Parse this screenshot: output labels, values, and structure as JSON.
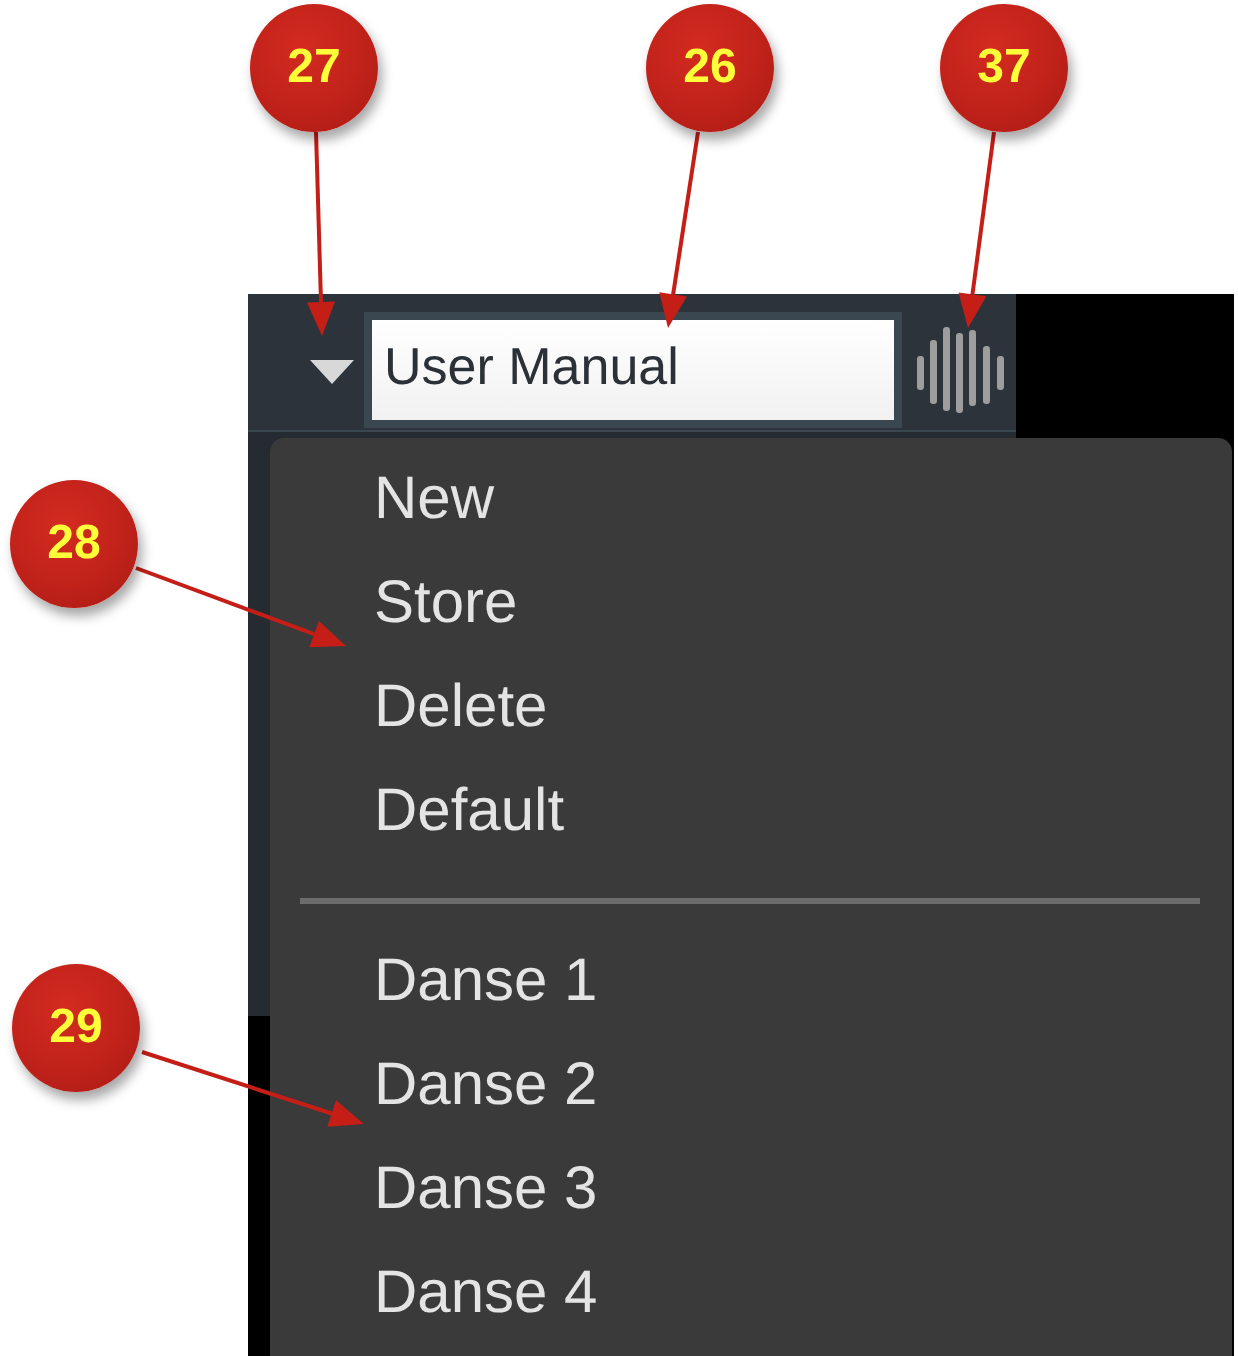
{
  "callouts": [
    {
      "number": "27"
    },
    {
      "number": "26"
    },
    {
      "number": "37"
    },
    {
      "number": "28"
    },
    {
      "number": "29"
    }
  ],
  "toolbar": {
    "preset_field": {
      "value": "User Manual"
    }
  },
  "preset_menu": {
    "sections": [
      {
        "items": [
          {
            "label": "New"
          },
          {
            "label": "Store"
          },
          {
            "label": "Delete"
          },
          {
            "label": "Default"
          }
        ]
      },
      {
        "items": [
          {
            "label": "Danse 1"
          },
          {
            "label": "Danse 2"
          },
          {
            "label": "Danse 3"
          },
          {
            "label": "Danse 4"
          }
        ]
      }
    ]
  }
}
